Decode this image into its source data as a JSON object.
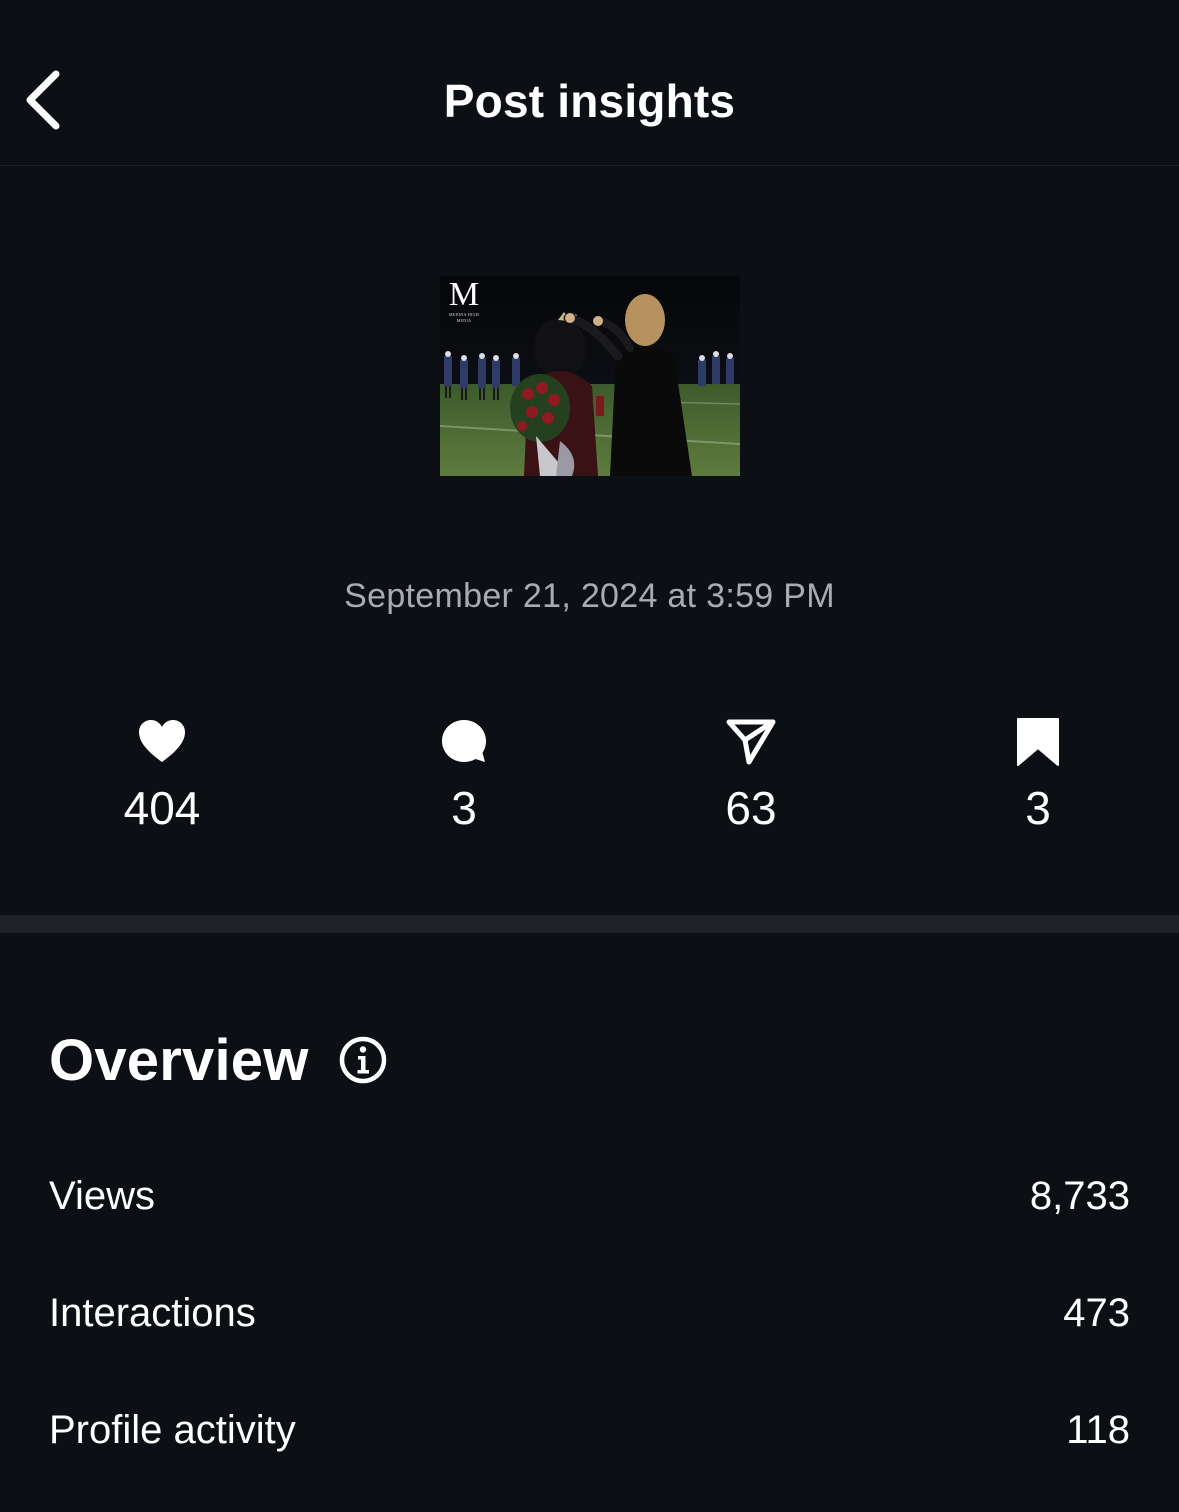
{
  "header": {
    "title": "Post insights",
    "back_icon": "chevron-left-icon"
  },
  "post": {
    "thumbnail_logo_mark": "M",
    "thumbnail_logo_subtext": "MEDINA HIGH MEDIA",
    "date": "September 21, 2024 at 3:59 PM"
  },
  "stats": {
    "likes": {
      "icon": "heart-icon",
      "value": "404"
    },
    "comments": {
      "icon": "comment-bubble-icon",
      "value": "3"
    },
    "shares": {
      "icon": "paper-plane-icon",
      "value": "63"
    },
    "saves": {
      "icon": "bookmark-icon",
      "value": "3"
    }
  },
  "overview": {
    "title": "Overview",
    "info_icon": "info-icon",
    "rows": [
      {
        "label": "Views",
        "value": "8,733"
      },
      {
        "label": "Interactions",
        "value": "473"
      },
      {
        "label": "Profile activity",
        "value": "118"
      }
    ]
  },
  "colors": {
    "background": "#0c0f14",
    "text_primary": "#ffffff",
    "text_secondary": "#a8abb1",
    "divider": "#1f2227"
  }
}
